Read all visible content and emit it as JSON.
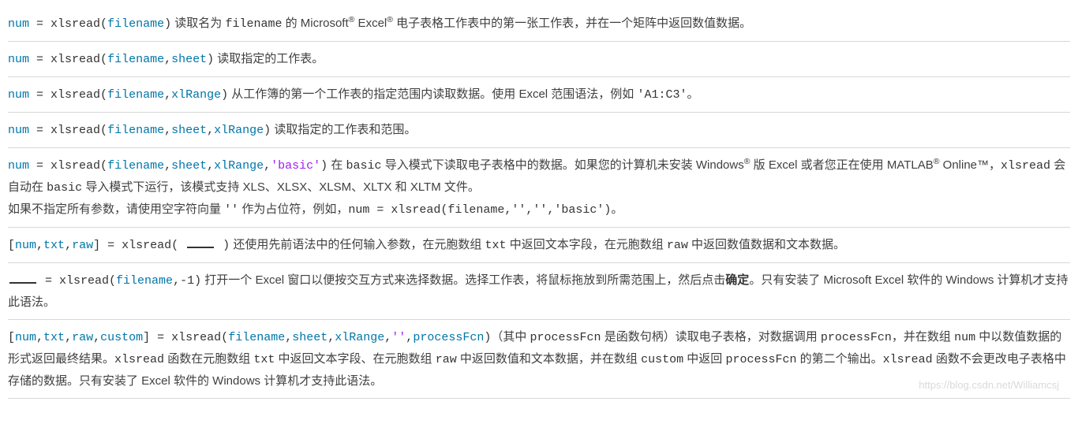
{
  "blocks": {
    "b1": {
      "num": "num",
      "eq": " = ",
      "fn": "xlsread",
      "lp": "(",
      "p1": "filename",
      "rp": ")",
      "txt1": " 读取名为 ",
      "mono1": "filename",
      "txt2": " 的 Microsoft",
      "sup1": "®",
      "txt3": " Excel",
      "sup2": "®",
      "txt4": " 电子表格工作表中的第一张工作表，并在一个矩阵中返回数值数据。"
    },
    "b2": {
      "num": "num",
      "eq": " = ",
      "fn": "xlsread",
      "lp": "(",
      "p1": "filename",
      "c1": ",",
      "p2": "sheet",
      "rp": ")",
      "txt1": " 读取指定的工作表。"
    },
    "b3": {
      "num": "num",
      "eq": " = ",
      "fn": "xlsread",
      "lp": "(",
      "p1": "filename",
      "c1": ",",
      "p2": "xlRange",
      "rp": ")",
      "txt1": " 从工作簿的第一个工作表的指定范围内读取数据。使用 Excel 范围语法，例如 ",
      "mono1": "'A1:C3'",
      "txt2": "。"
    },
    "b4": {
      "num": "num",
      "eq": " = ",
      "fn": "xlsread",
      "lp": "(",
      "p1": "filename",
      "c1": ",",
      "p2": "sheet",
      "c2": ",",
      "p3": "xlRange",
      "rp": ")",
      "txt1": " 读取指定的工作表和范围。"
    },
    "b5": {
      "num": "num",
      "eq": " = ",
      "fn": "xlsread",
      "lp": "(",
      "p1": "filename",
      "c1": ",",
      "p2": "sheet",
      "c2": ",",
      "p3": "xlRange",
      "c3": ",",
      "str1": "'basic'",
      "rp": ")",
      "txt1": " 在 ",
      "mono1": "basic",
      "txt2": " 导入模式下读取电子表格中的数据。如果您的计算机未安装 Windows",
      "sup1": "®",
      "txt3": " 版 Excel 或者您正在使用 MATLAB",
      "sup2": "®",
      "txt4": " Online™，",
      "mono2": "xlsread",
      "txt5": " 会自动在 ",
      "mono3": "basic",
      "txt6": " 导入模式下运行，该模式支持 XLS、XLSX、XLSM、XLTX 和 XLTM 文件。",
      "line2a": "如果不指定所有参数，请使用空字符向量 ",
      "mono4": "''",
      "line2b": " 作为占位符，例如，",
      "mono5": "num = xlsread(filename,'','','basic')",
      "line2c": "。"
    },
    "b6": {
      "lb": "[",
      "o1": "num",
      "c1": ",",
      "o2": "txt",
      "c2": ",",
      "o3": "raw",
      "rb": "]",
      "eq": " = ",
      "fn": "xlsread",
      "lp": "( ",
      "rp": " )",
      "txt1": " 还使用先前语法中的任何输入参数，在元胞数组 ",
      "mono1": "txt",
      "txt2": " 中返回文本字段，在元胞数组 ",
      "mono2": "raw",
      "txt3": " 中返回数值数据和文本数据。"
    },
    "b7": {
      "eq": " = ",
      "fn": "xlsread",
      "lp": "(",
      "p1": "filename",
      "c1": ",",
      "n1": "-1",
      "rp": ")",
      "txt1": " 打开一个 Excel 窗口以便按交互方式来选择数据。选择工作表，将鼠标拖放到所需范围上，然后点击",
      "bold1": "确定",
      "txt2": "。只有安装了 Microsoft Excel 软件的 Windows 计算机才支持此语法。"
    },
    "b8": {
      "lb": "[",
      "o1": "num",
      "c1": ",",
      "o2": "txt",
      "c2": ",",
      "o3": "raw",
      "c3": ",",
      "o4": "custom",
      "rb": "]",
      "eq": " = ",
      "fn": "xlsread",
      "lp": "(",
      "p1": "filename",
      "cc1": ",",
      "p2": "sheet",
      "cc2": ",",
      "p3": "xlRange",
      "cc3": ",",
      "str1": "''",
      "cc4": ",",
      "p4": "processFcn",
      "rp": ")",
      "txt1": "（其中 ",
      "mono1": "processFcn",
      "txt2": " 是函数句柄）读取电子表格，对数据调用 ",
      "mono2": "processFcn",
      "txt3": "，并在数组 ",
      "mono3": "num",
      "txt4": " 中以数值数据的形式返回最终结果。",
      "mono4": "xlsread",
      "txt5": " 函数在元胞数组 ",
      "mono5": "txt",
      "txt6": " 中返回文本字段、在元胞数组 ",
      "mono6": "raw",
      "txt7": " 中返回数值和文本数据，并在数组 ",
      "mono7": "custom",
      "txt8": " 中返回 ",
      "mono8": "processFcn",
      "txt9": " 的第二个输出。",
      "mono9": "xlsread",
      "txt10": " 函数不会更改电子表格中存储的数据。只有安装了 Excel 软件的 Windows 计算机才支持此语法。"
    }
  },
  "watermark": "https://blog.csdn.net/Williamcsj"
}
